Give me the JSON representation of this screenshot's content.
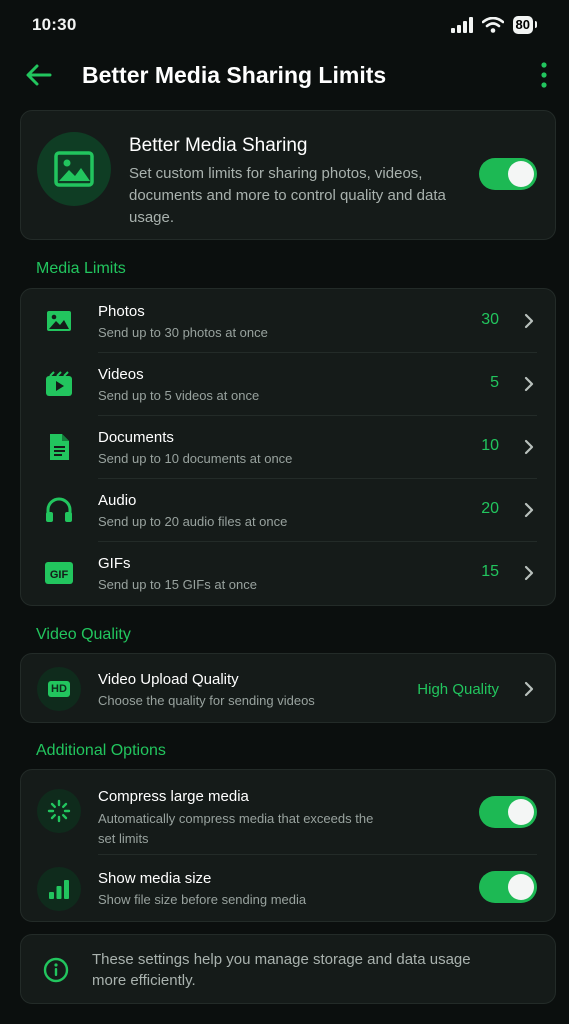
{
  "status_bar": {
    "time": "10:30",
    "battery": "80"
  },
  "header": {
    "title": "Better Media Sharing Limits"
  },
  "hero": {
    "title": "Better Media Sharing",
    "description": "Set custom limits for sharing photos, videos, documents and more to control quality and data usage.",
    "enabled": true
  },
  "media_limits": {
    "section_title": "Media Limits",
    "items": [
      {
        "icon": "image-icon",
        "title": "Photos",
        "subtitle": "Send up to 30 photos at once",
        "value": "30"
      },
      {
        "icon": "video-icon",
        "title": "Videos",
        "subtitle": "Send up to 5 videos at once",
        "value": "5"
      },
      {
        "icon": "document-icon",
        "title": "Documents",
        "subtitle": "Send up to 10 documents at once",
        "value": "10"
      },
      {
        "icon": "headphones-icon",
        "title": "Audio",
        "subtitle": "Send up to 20 audio files at once",
        "value": "20"
      },
      {
        "icon": "gif-icon",
        "title": "GIFs",
        "subtitle": "Send up to 15 GIFs at once",
        "value": "15"
      }
    ]
  },
  "video_quality": {
    "section_title": "Video Quality",
    "icon_label": "HD",
    "title": "Video Upload Quality",
    "subtitle": "Choose the quality for sending videos",
    "value": "High Quality"
  },
  "additional_options": {
    "section_title": "Additional Options",
    "compress": {
      "title": "Compress large media",
      "subtitle": "Automatically compress media that exceeds the set limits",
      "enabled": true
    },
    "show_size": {
      "title": "Show media size",
      "subtitle": "Show file size before sending media",
      "enabled": true
    }
  },
  "info": {
    "text": "These settings help you manage storage and data usage more efficiently."
  },
  "colors": {
    "accent": "#22c55e",
    "background": "#0b0f0e",
    "card": "#151b19"
  }
}
